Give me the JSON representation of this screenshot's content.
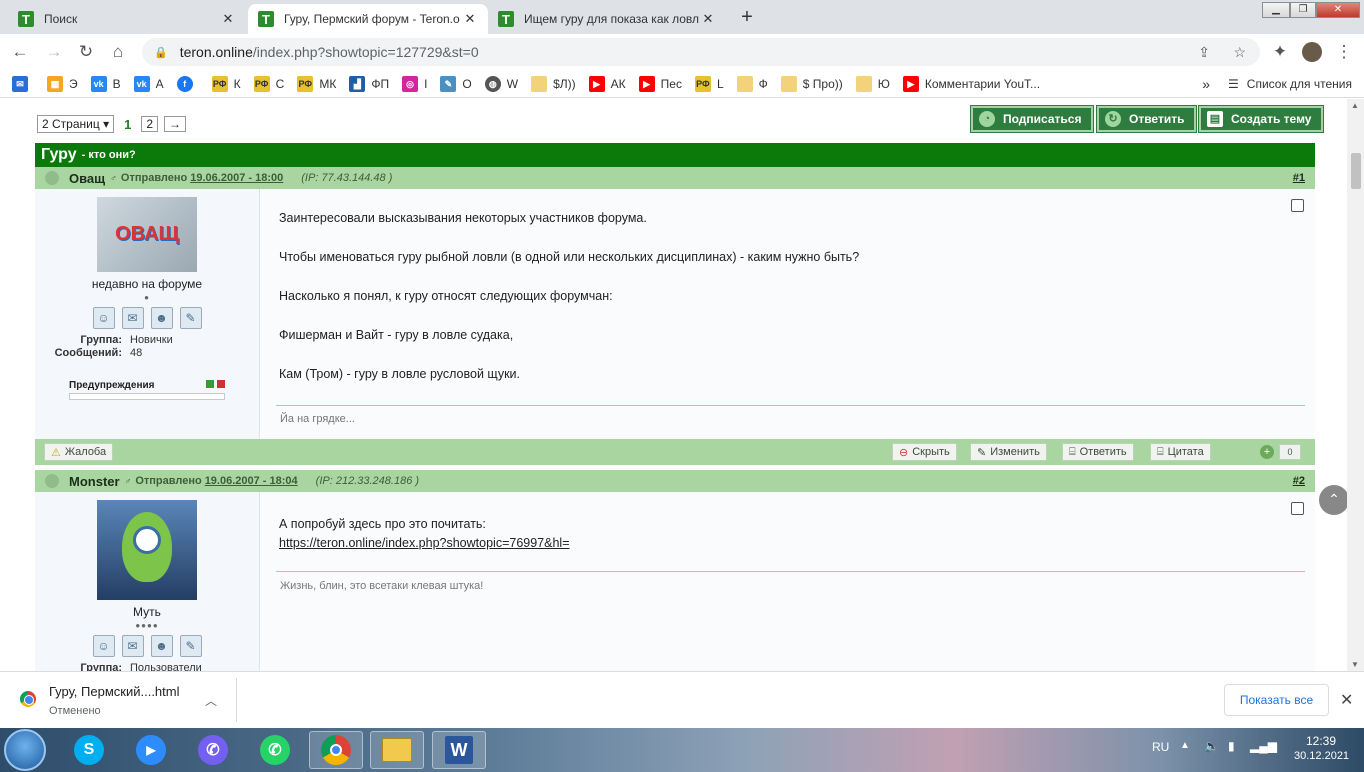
{
  "browser": {
    "tabs": [
      {
        "title": "Поиск",
        "active": false
      },
      {
        "title": "Гуру, Пермский форум - Teron.o",
        "active": true
      },
      {
        "title": "Ищем гуру для показа как ловл",
        "active": false
      }
    ],
    "new_tab": "+",
    "url_host": "teron.online",
    "url_path": "/index.php?showtopic=127729&st=0",
    "bookmarks": [
      {
        "label": "",
        "icon": "mail-icon",
        "color": "#2a6fd6"
      },
      {
        "label": "Э",
        "icon": "grid-icon",
        "color": "#f5a623"
      },
      {
        "label": "В",
        "icon": "vk-icon",
        "color": "#2787f5"
      },
      {
        "label": "А",
        "icon": "vk-icon",
        "color": "#2787f5"
      },
      {
        "label": "",
        "icon": "facebook-icon",
        "color": "#1877f2"
      },
      {
        "label": "К",
        "icon": "rf-icon",
        "color": "#e8c22e"
      },
      {
        "label": "С",
        "icon": "rf-icon",
        "color": "#e8c22e"
      },
      {
        "label": "МК",
        "icon": "rf-icon",
        "color": "#e8c22e"
      },
      {
        "label": "ФП",
        "icon": "chart-icon",
        "color": "#1d5fa8"
      },
      {
        "label": "I",
        "icon": "instagram-icon",
        "color": "#d6249f"
      },
      {
        "label": "О",
        "icon": "feather-icon",
        "color": "#4a90c2"
      },
      {
        "label": "W",
        "icon": "globe-icon",
        "color": "#555555"
      },
      {
        "label": "$Л))",
        "icon": "folder-icon",
        "color": "#f2d27a"
      },
      {
        "label": "АК",
        "icon": "youtube-icon",
        "color": "#ff0000"
      },
      {
        "label": "Пес",
        "icon": "youtube-icon",
        "color": "#ff0000"
      },
      {
        "label": "L",
        "icon": "rf-icon",
        "color": "#e8c22e"
      },
      {
        "label": "Ф",
        "icon": "folder-icon",
        "color": "#f2d27a"
      },
      {
        "label": "$ Про))",
        "icon": "folder-icon",
        "color": "#f2d27a"
      },
      {
        "label": "Ю",
        "icon": "folder-icon",
        "color": "#f2d27a"
      },
      {
        "label": "Комментарии YouT...",
        "icon": "youtube-icon",
        "color": "#ff0000"
      }
    ],
    "more": "»",
    "reading_list": "Список для чтения"
  },
  "forum": {
    "pages_select": "2 Страниц",
    "page_current": "1",
    "page_next": "2",
    "page_arrow": "→",
    "btn_subscribe": "Подписаться",
    "btn_reply": "Ответить",
    "btn_new_topic": "Создать тему",
    "topic_title": "Гуру",
    "topic_desc": "- кто они?",
    "posts": [
      {
        "author": "Оващ",
        "posted": "Отправлено",
        "date": "19.06.2007 - 18:00",
        "ip_label": "(IP:",
        "ip": "77.43.144.48",
        "ip_end": ")",
        "number": "#1",
        "avatar_text": "ОВАЩ",
        "status": "недавно на форуме",
        "pips": "●",
        "group_label": "Группа:",
        "group": "Новички",
        "posts_label": "Сообщений:",
        "posts_count": "48",
        "warnings": "Предупреждения",
        "lines": [
          "Заинтересовали высказывания некоторых участников форума.",
          "Чтобы именоваться гуру рыбной ловли (в одной или нескольких дисциплинах) - каким нужно быть?",
          "Насколько я понял, к гуру относят следующих форумчан:",
          "Фишерман и Вайт - гуру в ловле судака,",
          "Кам (Тром) - гуру в ловле русловой щуки."
        ],
        "signature": "Йа на грядке..."
      },
      {
        "author": "Monster",
        "posted": "Отправлено",
        "date": "19.06.2007 - 18:04",
        "ip_label": "(IP:",
        "ip": "212.33.248.186",
        "ip_end": ")",
        "number": "#2",
        "status": "Муть",
        "pips": "●●●●",
        "group_label": "Группа:",
        "group": "Пользователи",
        "line1": "А попробуй здесь про это почитать:",
        "link": "https://teron.online/index.php?showtopic=76997&hl=",
        "signature": "Жизнь, блин, это всетаки клевая штука!"
      }
    ],
    "actions": {
      "report": "Жалоба",
      "hide": "Скрыть",
      "edit": "Изменить",
      "reply": "Ответить",
      "quote": "Цитата",
      "rating": "0"
    }
  },
  "download": {
    "filename": "Гуру, Пермский....html",
    "status": "Отменено",
    "show_all": "Показать все"
  },
  "taskbar": {
    "lang": "RU",
    "time": "12:39",
    "date": "30.12.2021"
  },
  "colors": {
    "forum_green": "#0b7a0b",
    "post_header": "#a9d6a0",
    "button_green": "#2f7d3e",
    "link": "#1a73e8"
  }
}
